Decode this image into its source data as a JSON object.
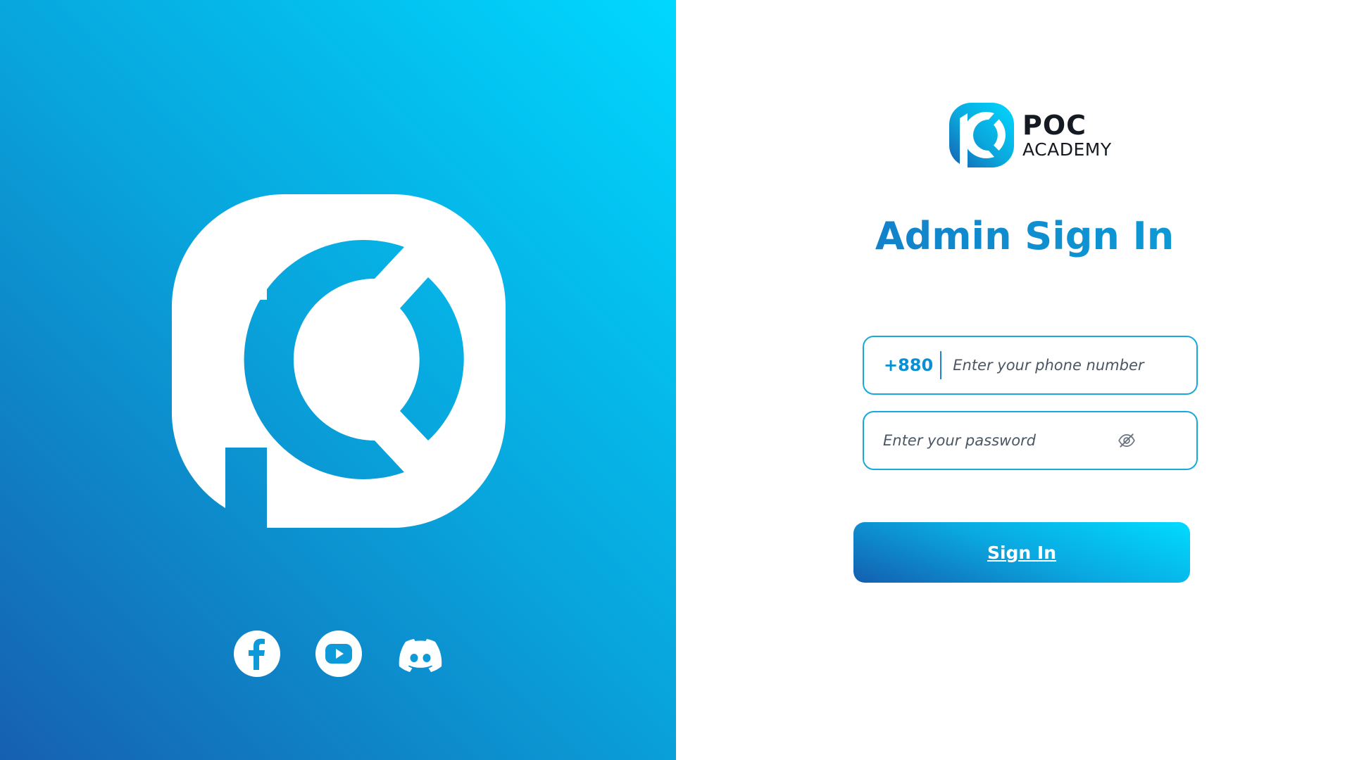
{
  "colors": {
    "accent": "#0aa6dc",
    "accent_dark": "#1660b0",
    "accent_light": "#00d8ff",
    "border": "#18a9dc",
    "text_dark": "#151a22"
  },
  "left_panel": {
    "logo_icon": "poc-logo-icon",
    "social": [
      {
        "name": "facebook",
        "icon": "facebook-icon"
      },
      {
        "name": "youtube",
        "icon": "youtube-icon"
      },
      {
        "name": "discord",
        "icon": "discord-icon"
      }
    ]
  },
  "brand": {
    "name": "POC",
    "subtitle": "ACADEMY"
  },
  "form": {
    "title": "Admin Sign In",
    "phone": {
      "country_code": "+880",
      "placeholder": "Enter your phone number",
      "value": ""
    },
    "password": {
      "placeholder": "Enter your password",
      "value": "",
      "toggle_icon": "eye-off-icon"
    },
    "submit_label": "Sign In"
  }
}
